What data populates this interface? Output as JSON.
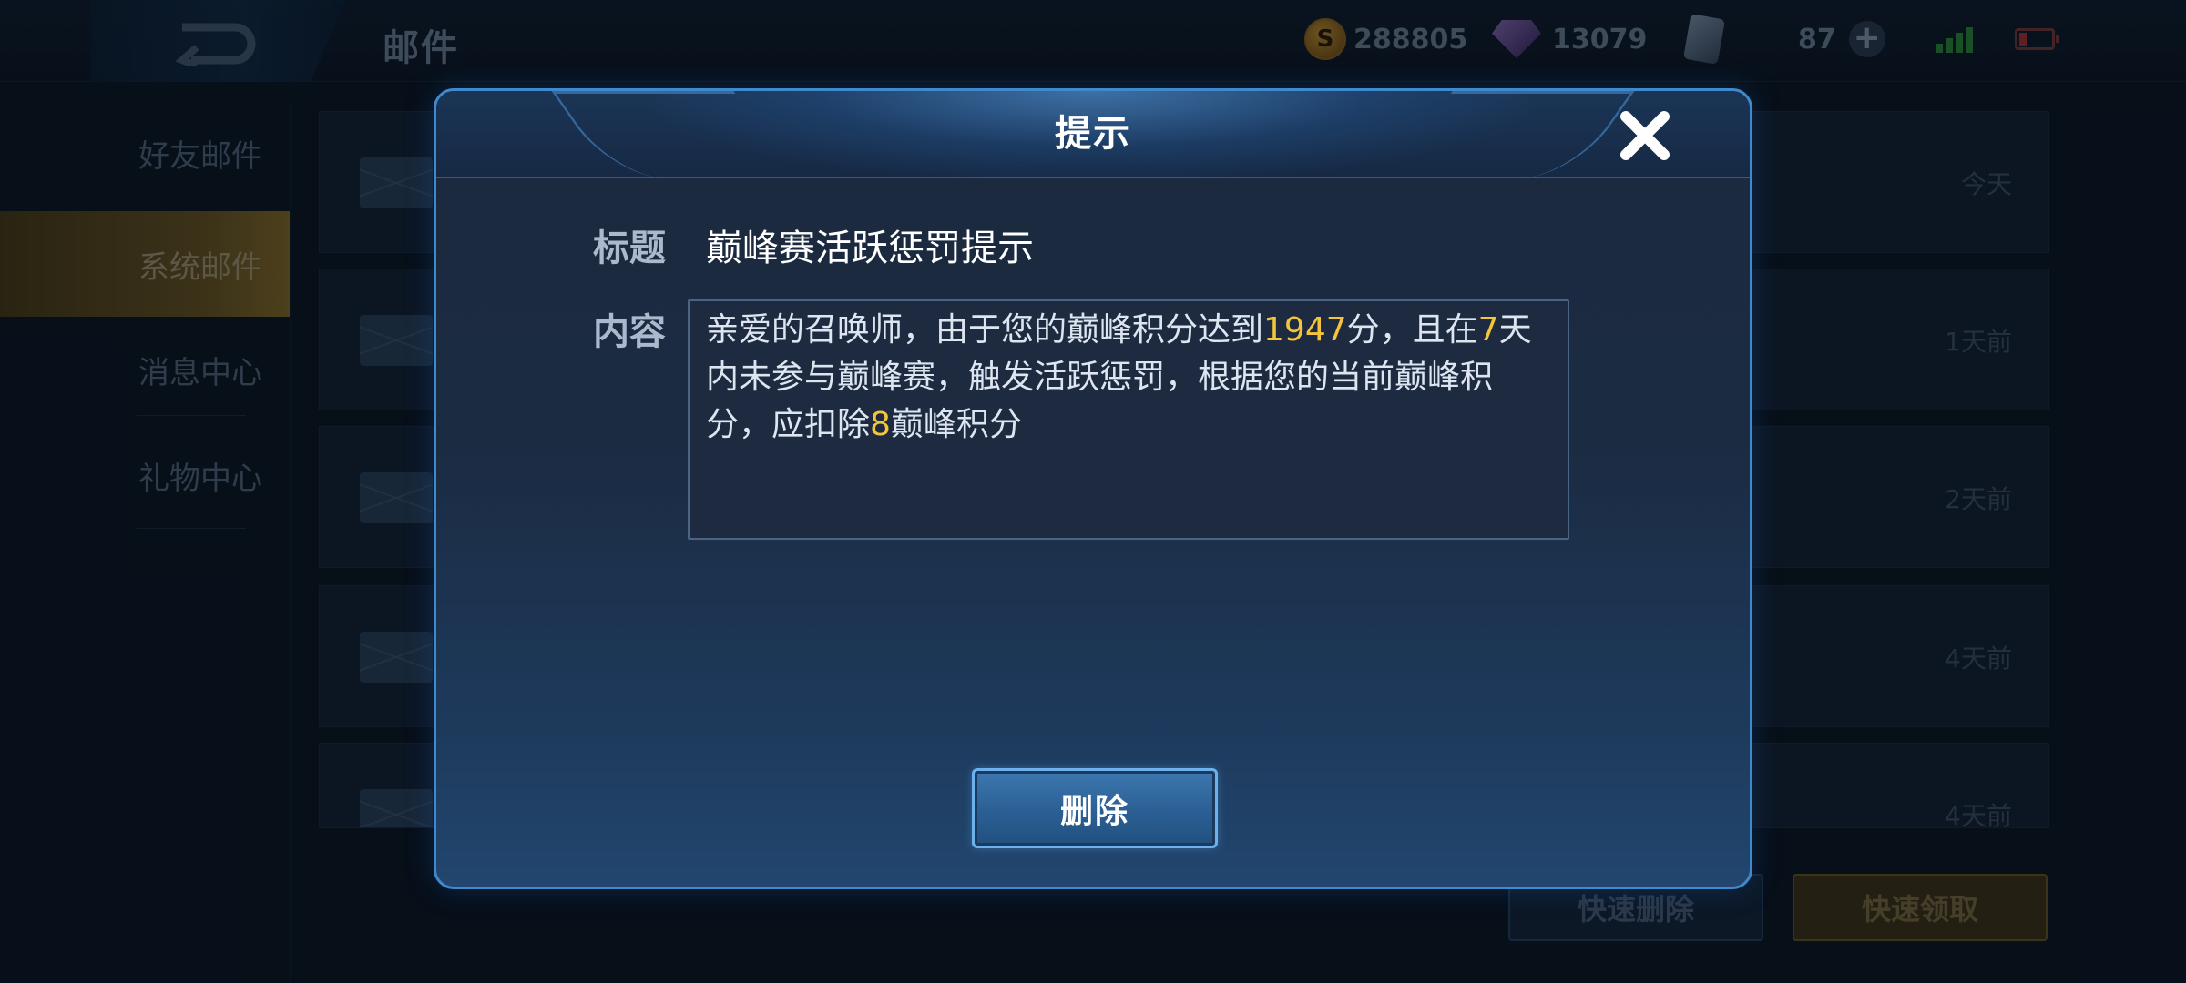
{
  "topbar": {
    "page_title": "邮件",
    "gold": "288805",
    "diamonds": "13079",
    "tickets": "87"
  },
  "sidebar": {
    "items": [
      {
        "label": "好友邮件",
        "active": false
      },
      {
        "label": "系统邮件",
        "active": true
      },
      {
        "label": "消息中心",
        "active": false
      },
      {
        "label": "礼物中心",
        "active": false
      }
    ]
  },
  "mail_list": {
    "rows": [
      {
        "subject": "",
        "time": "今天"
      },
      {
        "subject": "",
        "time": "1天前"
      },
      {
        "subject": "",
        "time": "2天前"
      },
      {
        "subject": "",
        "time": "4天前"
      },
      {
        "subject": "",
        "time": "4天前"
      }
    ],
    "quick_delete_label": "快速删除",
    "quick_claim_label": "快速领取"
  },
  "dialog": {
    "title": "提示",
    "subject_label": "标题",
    "subject_value": "巅峰赛活跃惩罚提示",
    "content_label": "内容",
    "content": {
      "part1": "亲爱的召唤师，由于您的巅峰积分达到",
      "score": "1947",
      "part2": "分，且在",
      "days": "7",
      "part3": "天内未参与巅峰赛，触发活跃惩罚，根据您的当前巅峰积分，应扣除",
      "deduct": "8",
      "part4": "巅峰积分"
    },
    "delete_label": "删除"
  },
  "colors": {
    "highlight": "#f2c53b",
    "dialog_border": "#3f8acc",
    "button_blue": "#2b5f94"
  },
  "icons": [
    "back-arrow-icon",
    "gold-coin-icon",
    "diamond-icon",
    "ticket-icon",
    "plus-icon",
    "signal-icon",
    "battery-icon",
    "envelope-icon",
    "close-icon"
  ]
}
